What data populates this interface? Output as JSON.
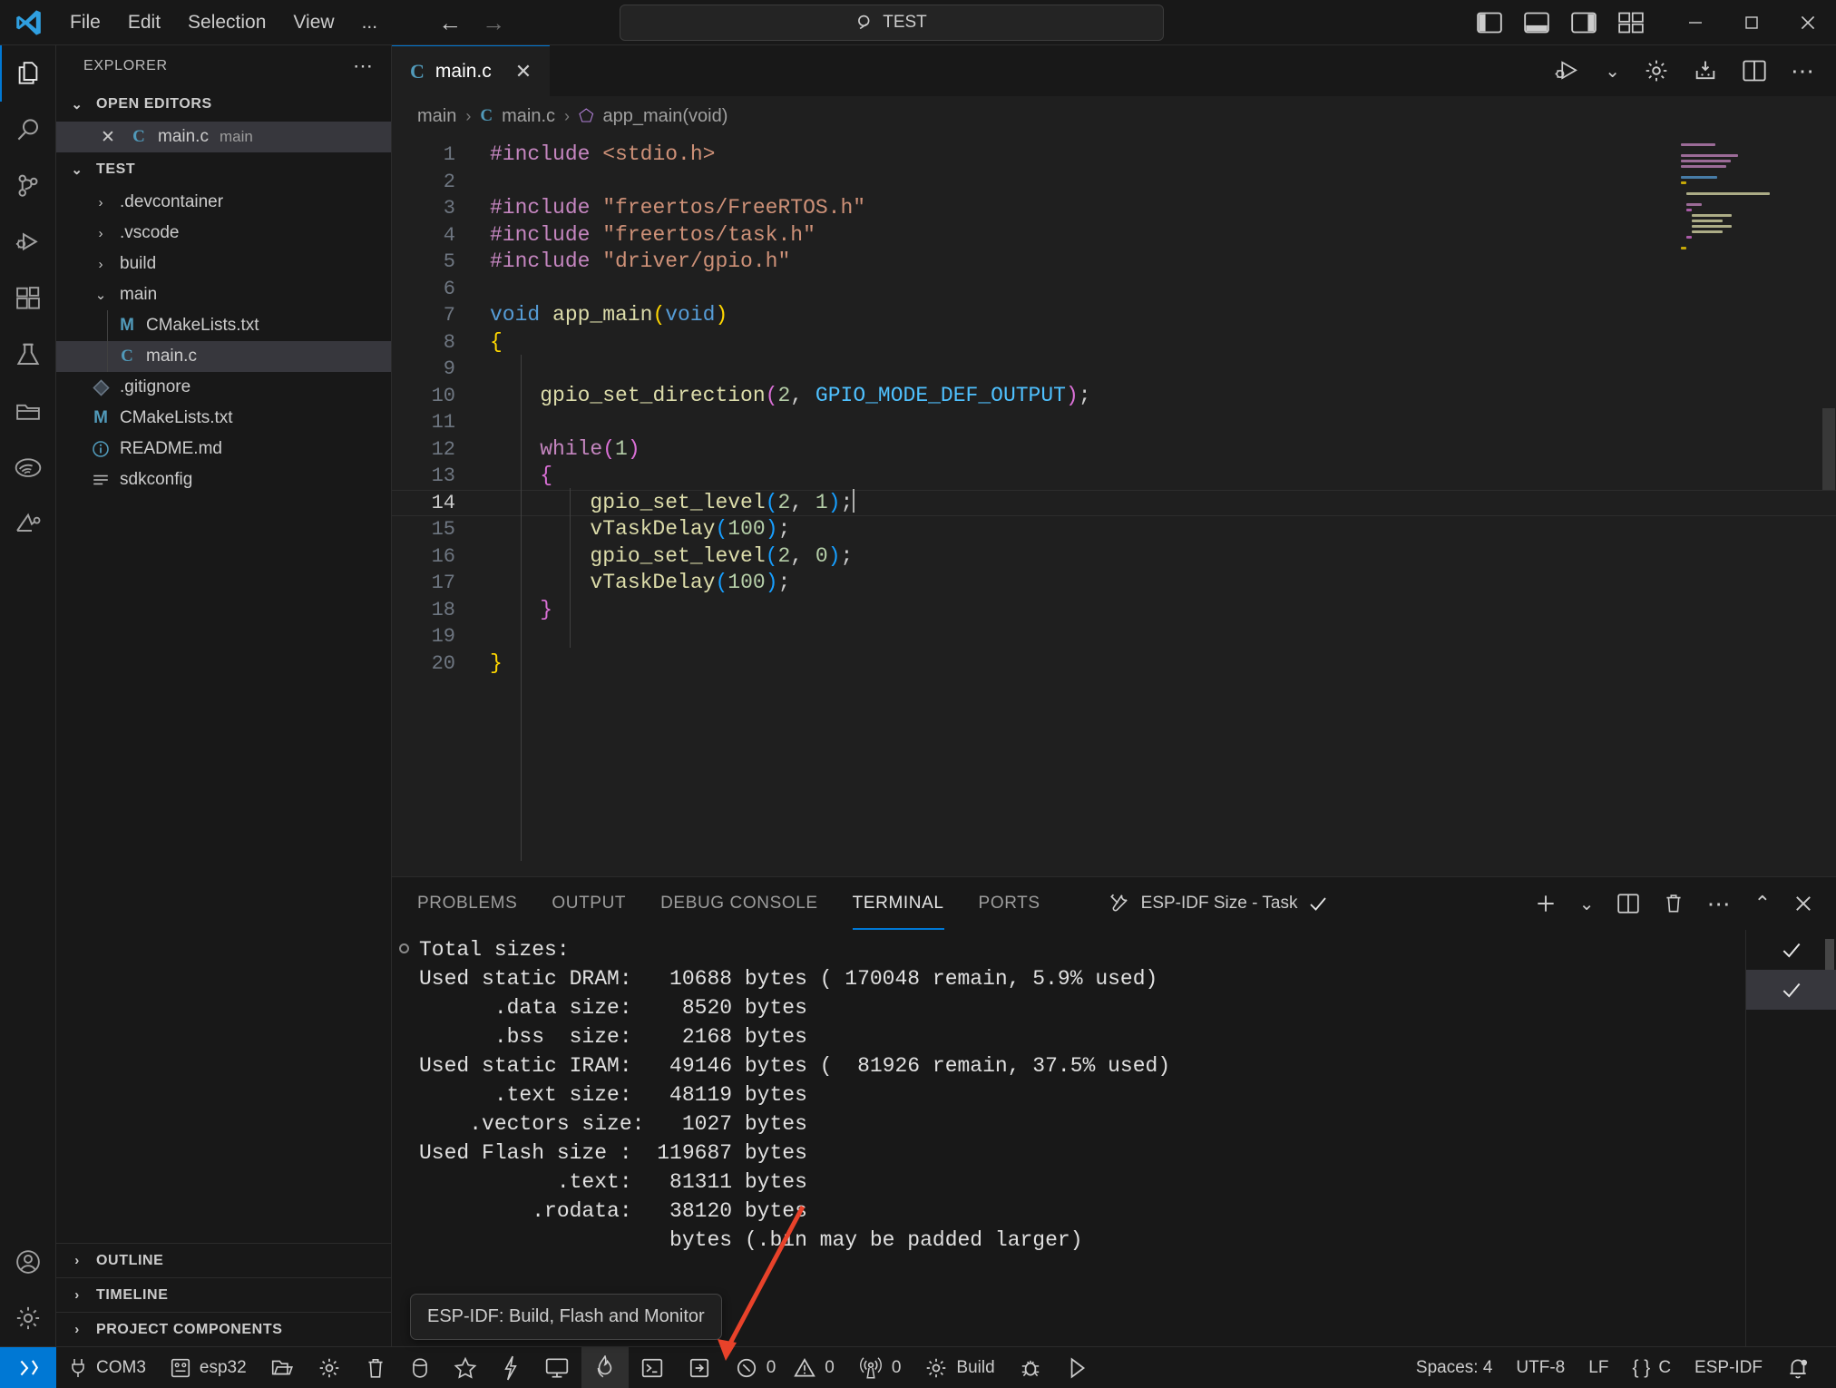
{
  "titlebar": {
    "logo_icon": "vscode-logo-icon",
    "menu": [
      "File",
      "Edit",
      "Selection",
      "View",
      "..."
    ],
    "back_icon": "arrow-left-icon",
    "forward_icon": "arrow-right-icon",
    "search": {
      "icon": "search-icon",
      "value": "TEST",
      "placeholder": "Search"
    },
    "layout_icons": [
      "toggle-primary-sidebar-icon",
      "toggle-panel-icon",
      "toggle-secondary-sidebar-icon",
      "customize-layout-icon"
    ],
    "window_controls": {
      "minimize": "minimize-icon",
      "maximize": "maximize-icon",
      "close": "close-icon"
    }
  },
  "activitybar": {
    "items": [
      {
        "name": "explorer",
        "icon": "files-icon",
        "active": true
      },
      {
        "name": "search",
        "icon": "search-icon",
        "active": false
      },
      {
        "name": "source-control",
        "icon": "source-control-icon",
        "active": false
      },
      {
        "name": "run-and-debug",
        "icon": "debug-icon",
        "active": false
      },
      {
        "name": "extensions",
        "icon": "extensions-icon",
        "active": false
      },
      {
        "name": "testing",
        "icon": "beaker-icon",
        "active": false
      },
      {
        "name": "project-files",
        "icon": "folder-library-icon",
        "active": false
      },
      {
        "name": "espressif",
        "icon": "espressif-logo-icon",
        "active": false
      },
      {
        "name": "platformio",
        "icon": "platformio-icon",
        "active": false
      }
    ],
    "bottom": [
      {
        "name": "accounts",
        "icon": "account-icon"
      },
      {
        "name": "settings",
        "icon": "gear-icon"
      }
    ]
  },
  "sidebar": {
    "title": "EXPLORER",
    "more_icon": "ellipsis-icon",
    "open_editors": {
      "label": "OPEN EDITORS",
      "expanded": true,
      "items": [
        {
          "close_icon": "close-icon",
          "badge": "C",
          "name": "main.c",
          "folder": "main",
          "selected": true
        }
      ]
    },
    "workspace": {
      "label": "TEST",
      "expanded": true,
      "items": [
        {
          "indent": 1,
          "chevron": "right",
          "icon": "folder-icon",
          "name": ".devcontainer",
          "selected": false
        },
        {
          "indent": 1,
          "chevron": "right",
          "icon": "folder-icon",
          "name": ".vscode",
          "selected": false
        },
        {
          "indent": 1,
          "chevron": "right",
          "icon": "folder-icon",
          "name": "build",
          "selected": false
        },
        {
          "indent": 1,
          "chevron": "down",
          "icon": "folder-icon",
          "name": "main",
          "selected": false
        },
        {
          "indent": 2,
          "chevron": "none",
          "icon": "markdown-file-icon",
          "badge": "M",
          "name": "CMakeLists.txt",
          "selected": false
        },
        {
          "indent": 2,
          "chevron": "none",
          "icon": "c-file-icon",
          "badge": "C",
          "name": "main.c",
          "selected": true
        },
        {
          "indent": 1,
          "chevron": "none",
          "icon": "git-icon",
          "name": ".gitignore",
          "selected": false
        },
        {
          "indent": 1,
          "chevron": "none",
          "icon": "markdown-file-icon",
          "badge": "M",
          "name": "CMakeLists.txt",
          "selected": false
        },
        {
          "indent": 1,
          "chevron": "none",
          "icon": "info-file-icon",
          "name": "README.md",
          "selected": false
        },
        {
          "indent": 1,
          "chevron": "none",
          "icon": "config-file-icon",
          "name": "sdkconfig",
          "selected": false
        }
      ]
    },
    "bottom_sections": [
      {
        "label": "OUTLINE",
        "expanded": false
      },
      {
        "label": "TIMELINE",
        "expanded": false
      },
      {
        "label": "PROJECT COMPONENTS",
        "expanded": false
      }
    ]
  },
  "editor": {
    "tabs": [
      {
        "badge": "C",
        "label": "main.c",
        "active": true,
        "close_icon": "close-icon"
      }
    ],
    "actions": [
      "run-and-debug-icon",
      "chevron-down-icon",
      "gear-icon",
      "esp-flash-icon",
      "split-editor-icon",
      "ellipsis-icon"
    ],
    "breadcrumb": [
      "main",
      "main.c",
      "app_main(void)"
    ],
    "breadcrumb_file_badge": "C",
    "breadcrumb_symbol_icon": "symbol-method-icon",
    "lines": [
      {
        "n": 1,
        "tokens": [
          {
            "t": "#include ",
            "c": "t-pre"
          },
          {
            "t": "<stdio.h>",
            "c": "t-str"
          }
        ]
      },
      {
        "n": 2,
        "tokens": []
      },
      {
        "n": 3,
        "tokens": [
          {
            "t": "#include ",
            "c": "t-pre"
          },
          {
            "t": "\"freertos/FreeRTOS.h\"",
            "c": "t-str"
          }
        ]
      },
      {
        "n": 4,
        "tokens": [
          {
            "t": "#include ",
            "c": "t-pre"
          },
          {
            "t": "\"freertos/task.h\"",
            "c": "t-str"
          }
        ]
      },
      {
        "n": 5,
        "tokens": [
          {
            "t": "#include ",
            "c": "t-pre"
          },
          {
            "t": "\"driver/gpio.h\"",
            "c": "t-str"
          }
        ]
      },
      {
        "n": 6,
        "tokens": []
      },
      {
        "n": 7,
        "tokens": [
          {
            "t": "void ",
            "c": "t-kw"
          },
          {
            "t": "app_main",
            "c": "t-fn"
          },
          {
            "t": "(",
            "c": "t-br1"
          },
          {
            "t": "void",
            "c": "t-kw"
          },
          {
            "t": ")",
            "c": "t-br1"
          }
        ]
      },
      {
        "n": 8,
        "tokens": [
          {
            "t": "{",
            "c": "t-br1"
          }
        ]
      },
      {
        "n": 9,
        "tokens": []
      },
      {
        "n": 10,
        "tokens": [
          {
            "t": "    ",
            "c": "t-plain"
          },
          {
            "t": "gpio_set_direction",
            "c": "t-fn"
          },
          {
            "t": "(",
            "c": "t-br2"
          },
          {
            "t": "2",
            "c": "t-num"
          },
          {
            "t": ", ",
            "c": "t-plain"
          },
          {
            "t": "GPIO_MODE_DEF_OUTPUT",
            "c": "t-const"
          },
          {
            "t": ")",
            "c": "t-br2"
          },
          {
            "t": ";",
            "c": "t-plain"
          }
        ]
      },
      {
        "n": 11,
        "tokens": []
      },
      {
        "n": 12,
        "tokens": [
          {
            "t": "    ",
            "c": "t-plain"
          },
          {
            "t": "while",
            "c": "t-pre"
          },
          {
            "t": "(",
            "c": "t-br2"
          },
          {
            "t": "1",
            "c": "t-num"
          },
          {
            "t": ")",
            "c": "t-br2"
          }
        ]
      },
      {
        "n": 13,
        "tokens": [
          {
            "t": "    ",
            "c": "t-plain"
          },
          {
            "t": "{",
            "c": "t-br2"
          }
        ]
      },
      {
        "n": 14,
        "tokens": [
          {
            "t": "        ",
            "c": "t-plain"
          },
          {
            "t": "gpio_set_level",
            "c": "t-fn"
          },
          {
            "t": "(",
            "c": "t-br3"
          },
          {
            "t": "2",
            "c": "t-num"
          },
          {
            "t": ", ",
            "c": "t-plain"
          },
          {
            "t": "1",
            "c": "t-num"
          },
          {
            "t": ")",
            "c": "t-br3"
          },
          {
            "t": ";",
            "c": "t-plain"
          }
        ],
        "cursor": true,
        "current": true
      },
      {
        "n": 15,
        "tokens": [
          {
            "t": "        ",
            "c": "t-plain"
          },
          {
            "t": "vTaskDelay",
            "c": "t-fn"
          },
          {
            "t": "(",
            "c": "t-br3"
          },
          {
            "t": "100",
            "c": "t-num"
          },
          {
            "t": ")",
            "c": "t-br3"
          },
          {
            "t": ";",
            "c": "t-plain"
          }
        ]
      },
      {
        "n": 16,
        "tokens": [
          {
            "t": "        ",
            "c": "t-plain"
          },
          {
            "t": "gpio_set_level",
            "c": "t-fn"
          },
          {
            "t": "(",
            "c": "t-br3"
          },
          {
            "t": "2",
            "c": "t-num"
          },
          {
            "t": ", ",
            "c": "t-plain"
          },
          {
            "t": "0",
            "c": "t-num"
          },
          {
            "t": ")",
            "c": "t-br3"
          },
          {
            "t": ";",
            "c": "t-plain"
          }
        ]
      },
      {
        "n": 17,
        "tokens": [
          {
            "t": "        ",
            "c": "t-plain"
          },
          {
            "t": "vTaskDelay",
            "c": "t-fn"
          },
          {
            "t": "(",
            "c": "t-br3"
          },
          {
            "t": "100",
            "c": "t-num"
          },
          {
            "t": ")",
            "c": "t-br3"
          },
          {
            "t": ";",
            "c": "t-plain"
          }
        ]
      },
      {
        "n": 18,
        "tokens": [
          {
            "t": "    ",
            "c": "t-plain"
          },
          {
            "t": "}",
            "c": "t-br2"
          }
        ]
      },
      {
        "n": 19,
        "tokens": []
      },
      {
        "n": 20,
        "tokens": [
          {
            "t": "}",
            "c": "t-br1"
          }
        ]
      }
    ]
  },
  "panel": {
    "tabs": [
      {
        "label": "PROBLEMS",
        "active": false
      },
      {
        "label": "OUTPUT",
        "active": false
      },
      {
        "label": "DEBUG CONSOLE",
        "active": false
      },
      {
        "label": "TERMINAL",
        "active": true
      },
      {
        "label": "PORTS",
        "active": false
      }
    ],
    "task": {
      "icon": "tools-icon",
      "label": "ESP-IDF Size - Task",
      "status_icon": "check-icon"
    },
    "actions": [
      "new-terminal-icon",
      "chevron-down-icon",
      "split-terminal-icon",
      "kill-terminal-icon",
      "ellipsis-icon",
      "chevron-up-icon",
      "close-icon"
    ],
    "terminal_lines": [
      "Total sizes:",
      "Used static DRAM:   10688 bytes ( 170048 remain, 5.9% used)",
      "      .data size:    8520 bytes",
      "      .bss  size:    2168 bytes",
      "Used static IRAM:   49146 bytes (  81926 remain, 37.5% used)",
      "      .text size:   48119 bytes",
      "    .vectors size:   1027 bytes",
      "Used Flash size :  119687 bytes",
      "           .text:   81311 bytes",
      "         .rodata:   38120 bytes",
      "                    bytes (.bin may be padded larger)"
    ],
    "side_checks": [
      "check-icon",
      "check-icon"
    ]
  },
  "tooltip": {
    "text": "ESP-IDF: Build, Flash and Monitor"
  },
  "statusbar": {
    "remote_icon": "remote-window-icon",
    "left_items": [
      {
        "name": "serial-port",
        "icon": "plug-icon",
        "label": "COM3"
      },
      {
        "name": "target-device",
        "icon": "chip-icon",
        "label": "esp32"
      },
      {
        "name": "open-folder",
        "icon": "folder-open-icon",
        "label": ""
      },
      {
        "name": "sdk-configuration",
        "icon": "gear-icon",
        "label": ""
      },
      {
        "name": "full-clean",
        "icon": "trash-icon",
        "label": ""
      },
      {
        "name": "flash-device",
        "icon": "database-icon",
        "label": ""
      },
      {
        "name": "favorites",
        "icon": "star-icon",
        "label": ""
      },
      {
        "name": "flash-lightning",
        "icon": "zap-icon",
        "label": ""
      },
      {
        "name": "monitor-device",
        "icon": "device-monitor-icon",
        "label": ""
      },
      {
        "name": "build-flash-monitor",
        "icon": "flame-icon",
        "label": "",
        "highlighted": true
      },
      {
        "name": "open-terminal",
        "icon": "terminal-icon",
        "label": ""
      },
      {
        "name": "custom-task",
        "icon": "export-icon",
        "label": ""
      },
      {
        "name": "problems-errors",
        "icon": "error-icon",
        "label": "0"
      },
      {
        "name": "problems-warnings",
        "icon": "warning-icon",
        "label": "0"
      },
      {
        "name": "radio-tower",
        "icon": "radio-tower-icon",
        "label": "0"
      },
      {
        "name": "build-task",
        "icon": "gear-icon",
        "label": "Build"
      },
      {
        "name": "debug-task",
        "icon": "bug-icon",
        "label": ""
      },
      {
        "name": "run-task",
        "icon": "play-icon",
        "label": ""
      }
    ],
    "right_items": [
      {
        "name": "indentation",
        "label": "Spaces: 4"
      },
      {
        "name": "encoding",
        "label": "UTF-8"
      },
      {
        "name": "eol",
        "label": "LF"
      },
      {
        "name": "language-mode",
        "icon": "braces-icon",
        "label": "C"
      },
      {
        "name": "esp-idf-version",
        "label": "ESP-IDF"
      },
      {
        "name": "notifications",
        "icon": "bell-dot-icon",
        "label": ""
      }
    ]
  },
  "colors": {
    "accent": "#0078d4",
    "titlebar_bg": "#181818",
    "editor_bg": "#1f1f1f",
    "annotation_arrow": "#e8422a"
  }
}
